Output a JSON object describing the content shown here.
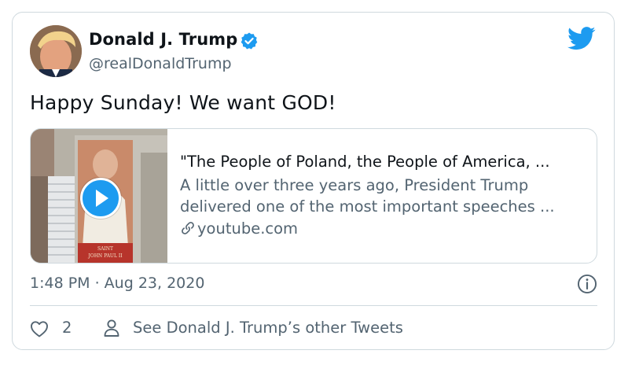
{
  "author": {
    "name": "Donald J. Trump",
    "handle": "@realDonaldTrump",
    "verified": true
  },
  "tweet": {
    "text": "Happy Sunday! We want GOD!",
    "timestamp": "1:48 PM · Aug 23, 2020"
  },
  "link_card": {
    "title": "\"The People of Poland, the People of America, ...",
    "description_lines": [
      "A little over three years ago, President Trump",
      "delivered one of the most important speeches ..."
    ],
    "domain": "youtube.com",
    "thumbnail_banner_text": "SAINT JOHN PAUL II"
  },
  "actions": {
    "like_count": "2",
    "see_more_label": "See Donald J. Trump’s other Tweets"
  },
  "colors": {
    "accent": "#1d9bf0",
    "text": "#0f1419",
    "secondary": "#536471",
    "border": "#cfd9de"
  },
  "icons": [
    "twitter-bird-icon",
    "verified-badge-icon",
    "play-icon",
    "link-icon",
    "info-icon",
    "heart-icon",
    "person-icon"
  ]
}
